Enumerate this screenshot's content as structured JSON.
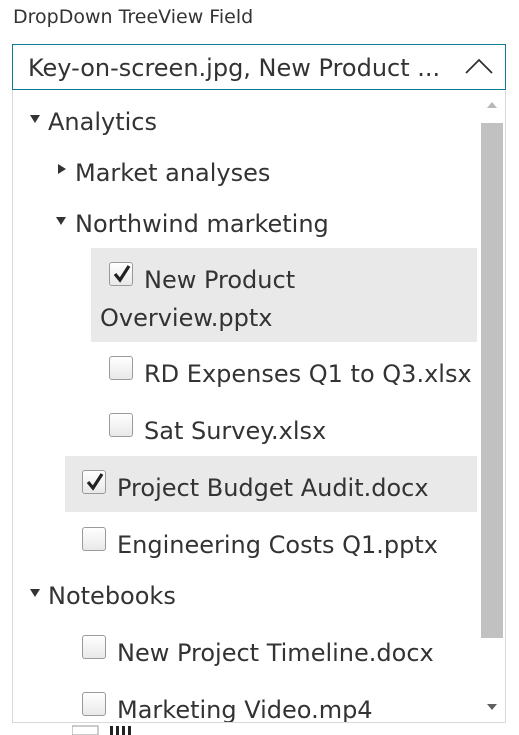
{
  "field": {
    "label": "DropDown TreeView Field",
    "value": "Key-on-screen.jpg, New Product ..."
  },
  "tree": {
    "analytics": "Analytics",
    "market_analyses": "Market analyses",
    "northwind_marketing": "Northwind marketing",
    "new_product_line1": "New Product",
    "new_product_line2": "Overview.pptx",
    "rd_expenses": "RD Expenses Q1 to Q3.xlsx",
    "sat_survey": "Sat Survey.xlsx",
    "project_budget": "Project Budget Audit.docx",
    "engineering_costs": "Engineering Costs Q1.pptx",
    "notebooks": "Notebooks",
    "new_project_timeline": "New Project Timeline.docx",
    "marketing_video": "Marketing Video.mp4"
  },
  "colors": {
    "focus_border": "#0f7a94",
    "selected_background": "#e9e9e9",
    "scroll_thumb": "#c1c1c1"
  }
}
